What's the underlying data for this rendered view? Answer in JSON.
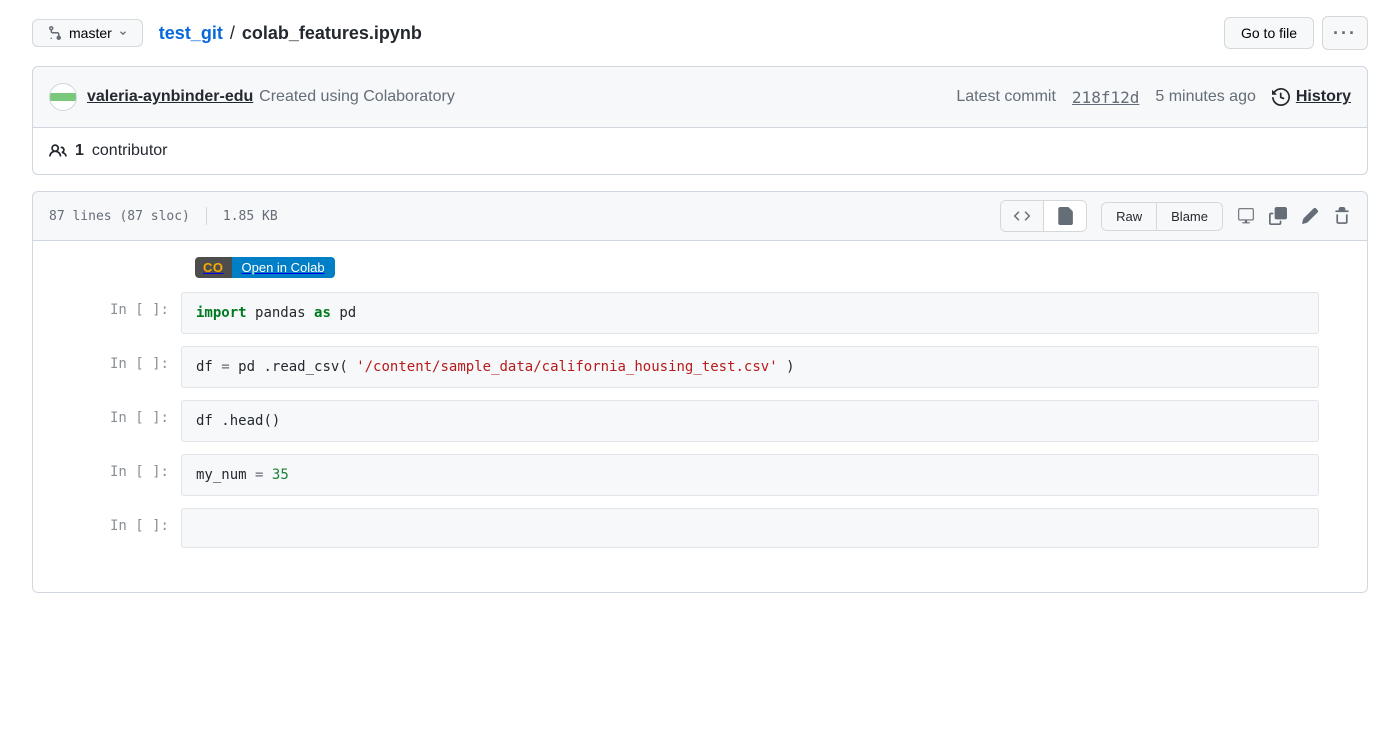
{
  "branch": "master",
  "breadcrumb": {
    "repo": "test_git",
    "file": "colab_features.ipynb"
  },
  "go_to_file": "Go to file",
  "commit": {
    "author": "valeria-aynbinder-edu",
    "message": "Created using Colaboratory",
    "latest_label": "Latest commit",
    "sha": "218f12d",
    "time": "5 minutes ago",
    "history_label": "History"
  },
  "contributors": {
    "count": "1",
    "label": "contributor"
  },
  "file_meta": {
    "lines": "87 lines (87 sloc)",
    "size": "1.85 KB",
    "raw": "Raw",
    "blame": "Blame"
  },
  "colab": {
    "left": "CO",
    "right": "Open in Colab"
  },
  "cells": {
    "prompt": "In [ ]:",
    "c1": {
      "kw1": "import",
      "p1": "pandas",
      "kw2": "as",
      "p2": "pd"
    },
    "c2": {
      "a": "df ",
      "op": "=",
      "b": " pd",
      "c": ".read_csv(",
      "s": "'/content/sample_data/california_housing_test.csv'",
      "d": ")"
    },
    "c3": {
      "a": "df",
      "b": ".head()"
    },
    "c4": {
      "a": "my_num ",
      "op": "=",
      "n": " 35"
    }
  }
}
